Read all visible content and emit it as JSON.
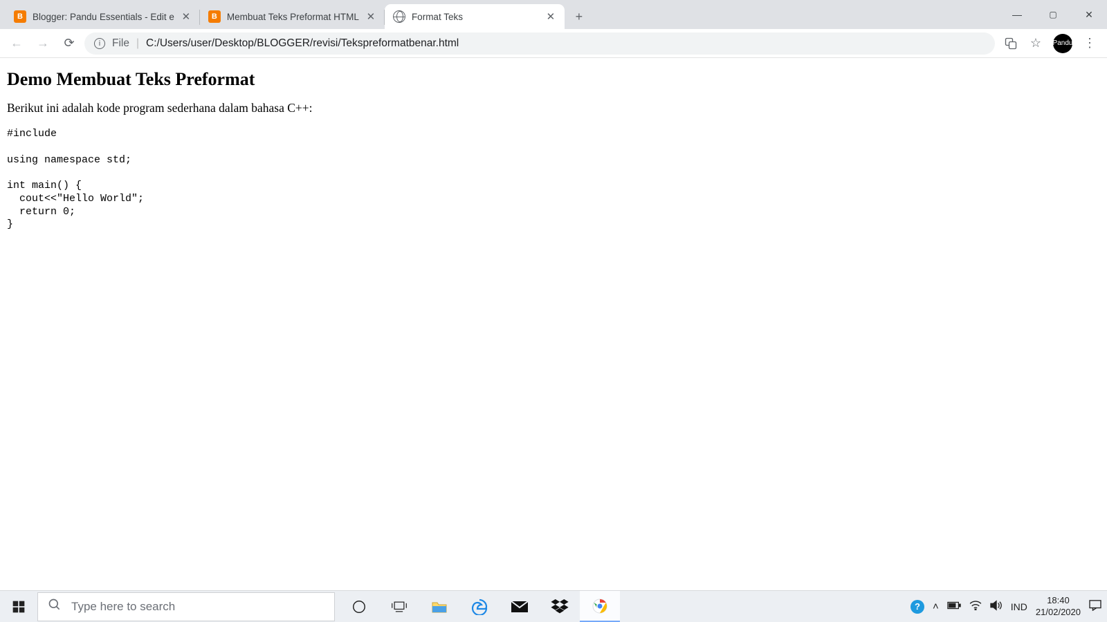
{
  "tabs": [
    {
      "title": "Blogger: Pandu Essentials - Edit e",
      "favicon": "blogger",
      "active": false
    },
    {
      "title": "Membuat Teks Preformat HTML",
      "favicon": "blogger",
      "active": false
    },
    {
      "title": "Format Teks",
      "favicon": "globe",
      "active": true
    }
  ],
  "newtab_glyph": "+",
  "window_controls": {
    "minimize": "—",
    "maximize": "▢",
    "close": "✕"
  },
  "toolbar": {
    "info_glyph": "i",
    "scheme_label": "File",
    "url_path": "C:/Users/user/Desktop/BLOGGER/revisi/Tekspreformatbenar.html",
    "translate_glyph": "⠿",
    "star_glyph": "☆",
    "avatar_label": "Pandu",
    "menu_glyph": "⋮"
  },
  "page": {
    "heading": "Demo Membuat Teks Preformat",
    "paragraph": "Berikut ini adalah kode program sederhana dalam bahasa C++:",
    "code": "#include\n\nusing namespace std;\n\nint main() {\n  cout<<\"Hello World\";\n  return 0;\n}"
  },
  "taskbar": {
    "search_placeholder": "Type here to search",
    "language": "IND",
    "time": "18:40",
    "date": "21/02/2020"
  }
}
